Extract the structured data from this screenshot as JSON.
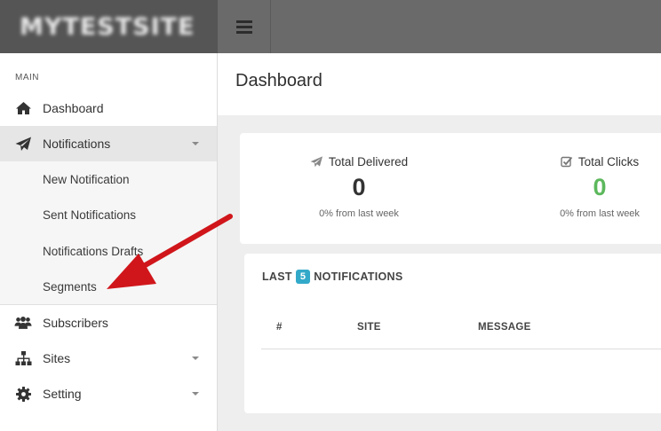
{
  "brand": {
    "name": "MYTESTSITE"
  },
  "sidebar": {
    "heading": "MAIN",
    "items": [
      {
        "label": "Dashboard",
        "icon": "home-icon"
      },
      {
        "label": "Notifications",
        "icon": "paper-plane-icon"
      },
      {
        "label": "Subscribers",
        "icon": "users-icon"
      },
      {
        "label": "Sites",
        "icon": "sitemap-icon"
      },
      {
        "label": "Setting",
        "icon": "gear-icon"
      }
    ],
    "notifications_submenu": [
      {
        "label": "New Notification"
      },
      {
        "label": "Sent Notifications"
      },
      {
        "label": "Notifications Drafts"
      },
      {
        "label": "Segments"
      }
    ]
  },
  "main": {
    "title": "Dashboard",
    "stats": [
      {
        "label": "Total Delivered",
        "value": "0",
        "sub": "0% from last week",
        "icon": "paper-plane-icon"
      },
      {
        "label": "Total Clicks",
        "value": "0",
        "sub": "0% from last week",
        "icon": "checkbox-icon"
      }
    ],
    "last_notifications": {
      "prefix": "LAST",
      "count": "5",
      "suffix": "NOTIFICATIONS",
      "columns": [
        "#",
        "SITE",
        "MESSAGE"
      ]
    }
  },
  "colors": {
    "topbar": "#6a6a6a",
    "brand_bg": "#555555",
    "accent_badge": "#33a9c9",
    "clicks_value": "#5cb85c",
    "annotation_arrow": "#d0161b"
  }
}
